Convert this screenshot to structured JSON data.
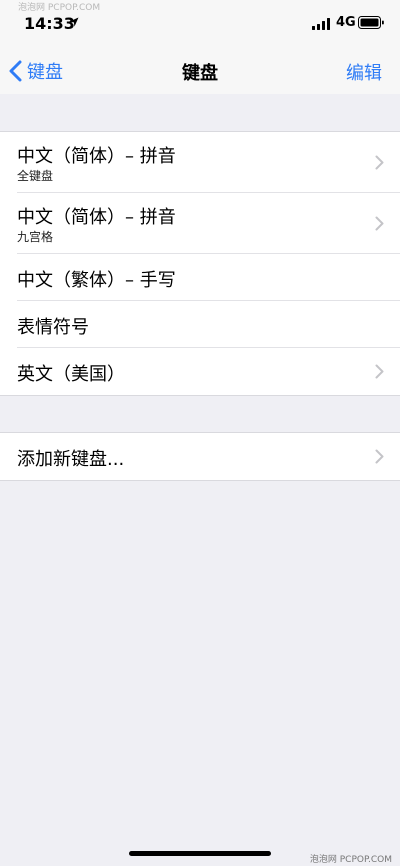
{
  "status_bar": {
    "time": "14:33",
    "network": "4G",
    "watermark_top": "泡泡网 PCPOP.COM",
    "icons": [
      "location-arrow-icon",
      "cellular-signal-icon",
      "battery-icon"
    ]
  },
  "nav": {
    "back_label": "键盘",
    "title": "键盘",
    "edit_label": "编辑"
  },
  "keyboards": [
    {
      "title": "中文（简体）– 拼音",
      "subtitle": "全键盘",
      "has_chevron": true
    },
    {
      "title": "中文（简体）– 拼音",
      "subtitle": "九宫格",
      "has_chevron": true
    },
    {
      "title": "中文（繁体）– 手写",
      "subtitle": "",
      "has_chevron": false
    },
    {
      "title": "表情符号",
      "subtitle": "",
      "has_chevron": false
    },
    {
      "title": "英文（美国）",
      "subtitle": "",
      "has_chevron": true
    }
  ],
  "add_keyboard": {
    "label": "添加新键盘..."
  },
  "footer": {
    "watermark": "泡泡网 PCPOP.COM"
  },
  "colors": {
    "accent": "#2f7cf6",
    "background": "#efeff4",
    "chevron": "#c4c4c8"
  }
}
